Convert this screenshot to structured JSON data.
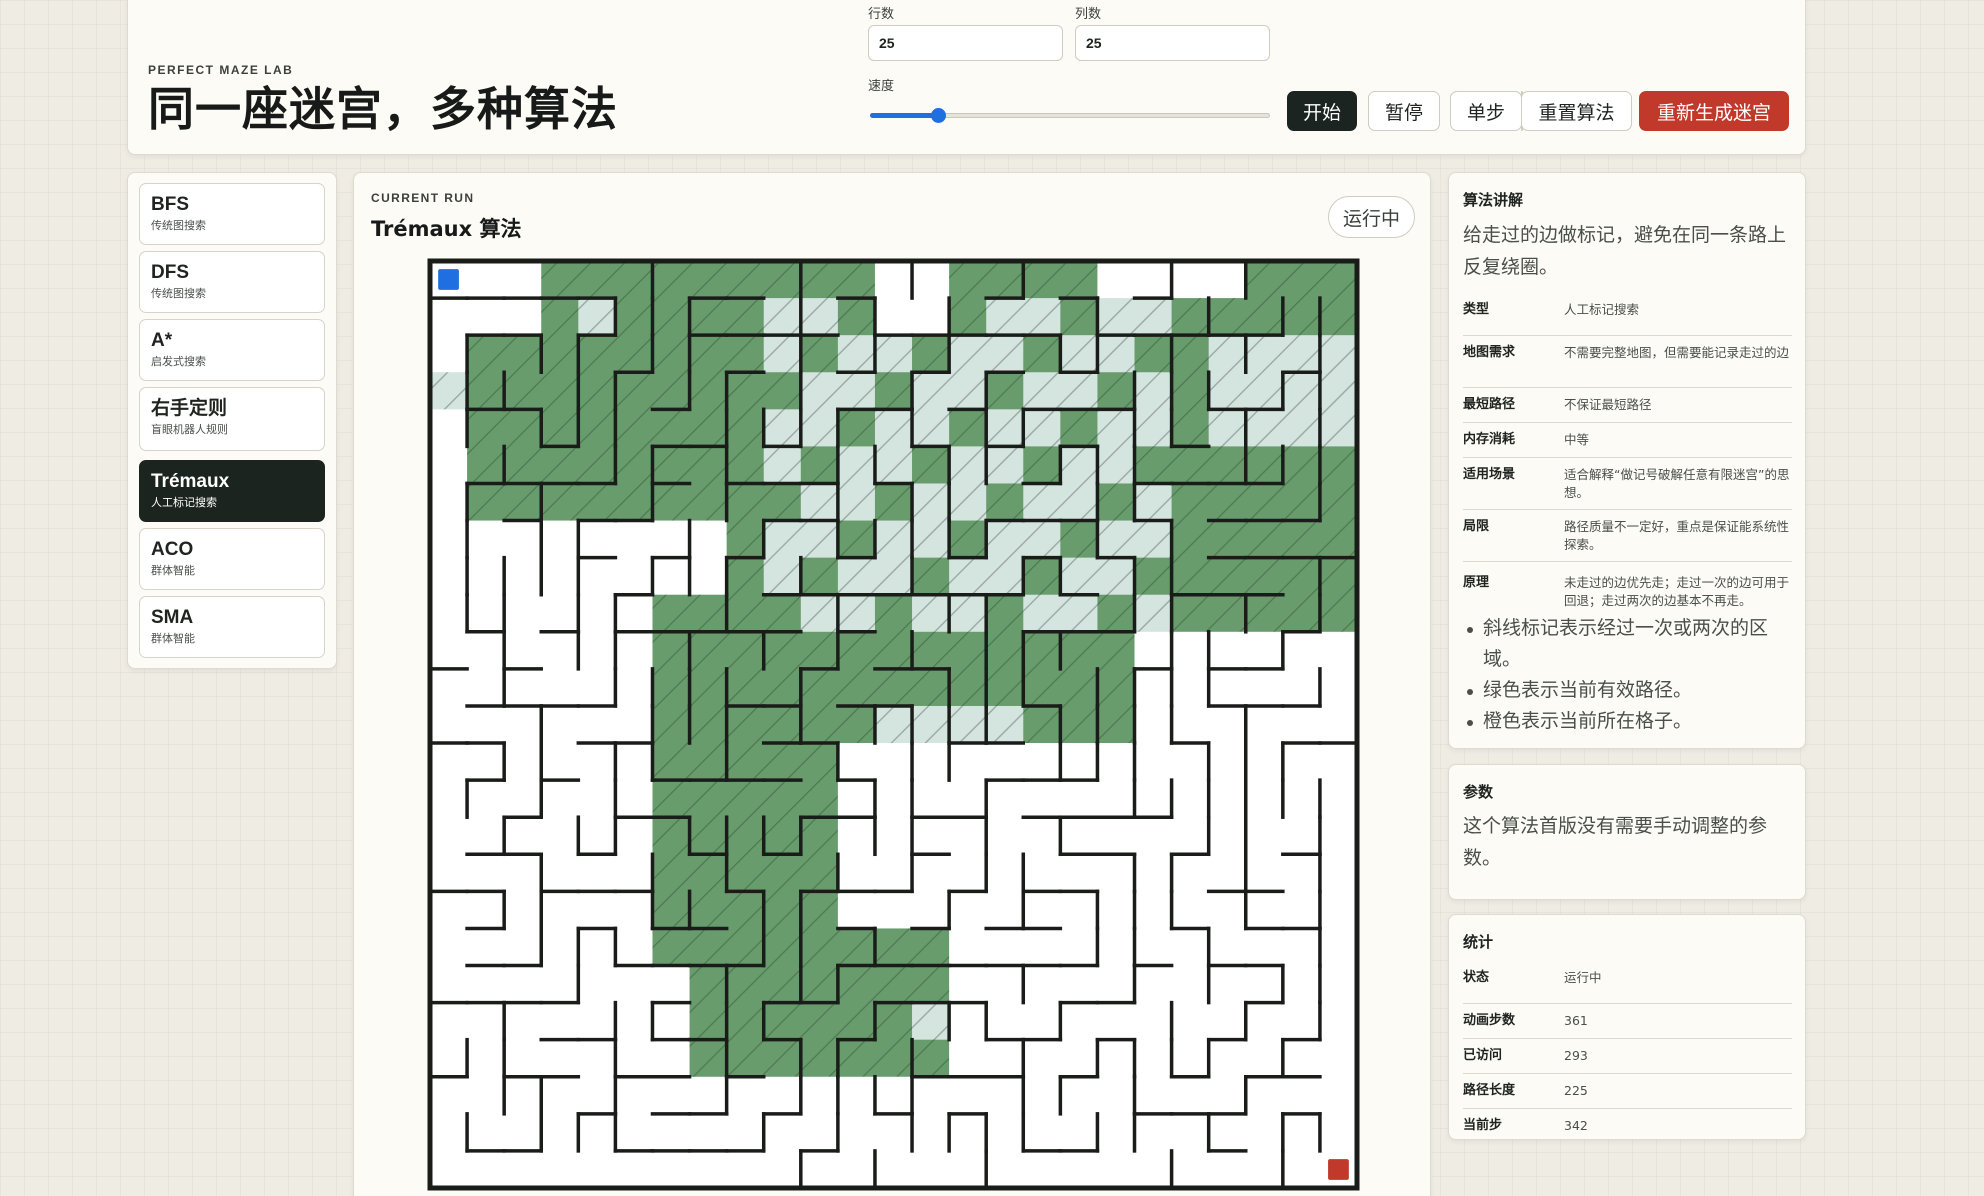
{
  "header": {
    "eyebrow": "PERFECT MAZE LAB",
    "title": "同一座迷宫，多种算法",
    "rows_label": "行数",
    "rows_value": "25",
    "cols_label": "列数",
    "cols_value": "25",
    "speed_label": "速度",
    "speed_level": 0.17,
    "buttons": {
      "start": "开始",
      "pause": "暂停",
      "step": "单步",
      "reset": "重置算法",
      "regenerate": "重新生成迷宫"
    }
  },
  "sidebar": {
    "items": [
      {
        "name": "BFS",
        "subtitle": "传统图搜索"
      },
      {
        "name": "DFS",
        "subtitle": "传统图搜索"
      },
      {
        "name": "A*",
        "subtitle": "启发式搜索"
      },
      {
        "name": "右手定则",
        "subtitle": "盲眼机器人规则"
      },
      {
        "name": "Trémaux",
        "subtitle": "人工标记搜索"
      },
      {
        "name": "ACO",
        "subtitle": "群体智能"
      },
      {
        "name": "SMA",
        "subtitle": "群体智能"
      }
    ],
    "active_index": 4
  },
  "main": {
    "eyebrow": "CURRENT RUN",
    "title": "Trémaux 算法",
    "status_pill": "运行中",
    "maze": {
      "rows": 25,
      "cols": 25,
      "start_cell": [
        0,
        0
      ],
      "goal_cell": [
        24,
        24
      ],
      "colors": {
        "path": "#689c6c",
        "visited_once": "#d4e4df",
        "wall": "#1a1c1a",
        "start": "#1f6fe0",
        "goal": "#c0392b",
        "empty": "#ffffff"
      }
    }
  },
  "explain": {
    "title": "算法讲解",
    "description": "给走过的边做标记，避免在同一条路上反复绕圈。",
    "rows": [
      {
        "key": "类型",
        "value": "人工标记搜索"
      },
      {
        "key": "地图需求",
        "value": "不需要完整地图，但需要能记录走过的边"
      },
      {
        "key": "最短路径",
        "value": "不保证最短路径"
      },
      {
        "key": "内存消耗",
        "value": "中等"
      },
      {
        "key": "适用场景",
        "value": "适合解释“做记号破解任意有限迷宫”的思想。"
      },
      {
        "key": "局限",
        "value": "路径质量不一定好，重点是保证能系统性探索。"
      },
      {
        "key": "原理",
        "value": "未走过的边优先走；走过一次的边可用于回退；走过两次的边基本不再走。"
      }
    ],
    "bullets": [
      "斜线标记表示经过一次或两次的区域。",
      "绿色表示当前有效路径。",
      "橙色表示当前所在格子。"
    ]
  },
  "params": {
    "title": "参数",
    "description": "这个算法首版没有需要手动调整的参数。"
  },
  "stats": {
    "title": "统计",
    "rows": [
      {
        "key": "状态",
        "value": "运行中"
      },
      {
        "key": "动画步数",
        "value": "361"
      },
      {
        "key": "已访问",
        "value": "293"
      },
      {
        "key": "路径长度",
        "value": "225"
      },
      {
        "key": "当前步",
        "value": "342"
      }
    ]
  }
}
